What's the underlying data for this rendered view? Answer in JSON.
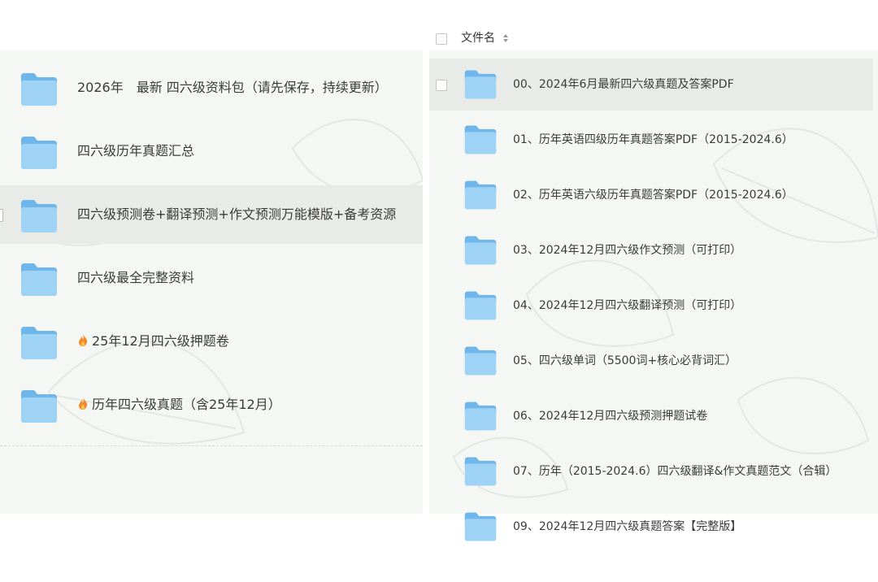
{
  "left_list": {
    "items": [
      {
        "label": "2026年　最新  四六级资料包（请先保存，持续更新）",
        "icon": "folder-icon",
        "hot": false
      },
      {
        "label": "四六级历年真题汇总",
        "icon": "folder-icon",
        "hot": false
      },
      {
        "label": "四六级预测卷+翻译预测+作文预测万能模版+备考资源",
        "icon": "folder-icon",
        "hot": false,
        "selected": true
      },
      {
        "label": "四六级最全完整资料",
        "icon": "folder-icon",
        "hot": false
      },
      {
        "label": "25年12月四六级押题卷",
        "icon": "folder-icon",
        "hot": true
      },
      {
        "label": "历年四六级真题（含25年12月）",
        "icon": "folder-icon",
        "hot": true
      }
    ]
  },
  "file_table": {
    "header": {
      "column": "文件名",
      "sort_icon": "sort-icon"
    },
    "rows": [
      {
        "name": "00、2024年6月最新四六级真题及答案PDF",
        "icon": "folder-icon",
        "selected": true
      },
      {
        "name": "01、历年英语四级历年真题答案PDF（2015-2024.6）",
        "icon": "folder-icon"
      },
      {
        "name": "02、历年英语六级历年真题答案PDF（2015-2024.6）",
        "icon": "folder-icon"
      },
      {
        "name": "03、2024年12月四六级作文预测（可打印）",
        "icon": "folder-icon"
      },
      {
        "name": "04、2024年12月四六级翻译预测（可打印）",
        "icon": "folder-icon"
      },
      {
        "name": "05、四六级单词（5500词+核心必背词汇）",
        "icon": "folder-icon"
      },
      {
        "name": "06、2024年12月四六级预测押题试卷",
        "icon": "folder-icon"
      },
      {
        "name": "07、历年（2015-2024.6）四六级翻译&作文真题范文（合辑）",
        "icon": "folder-icon"
      },
      {
        "name": "09、2024年12月四六级真题答案【完整版】",
        "icon": "folder-icon"
      }
    ]
  },
  "colors": {
    "background_tint": "#f4f7f3",
    "selected_row": "#e9ebe8",
    "folder_light": "#9fd3f6",
    "folder_dark": "#6fb6ea",
    "flame": "#f08a2c"
  }
}
